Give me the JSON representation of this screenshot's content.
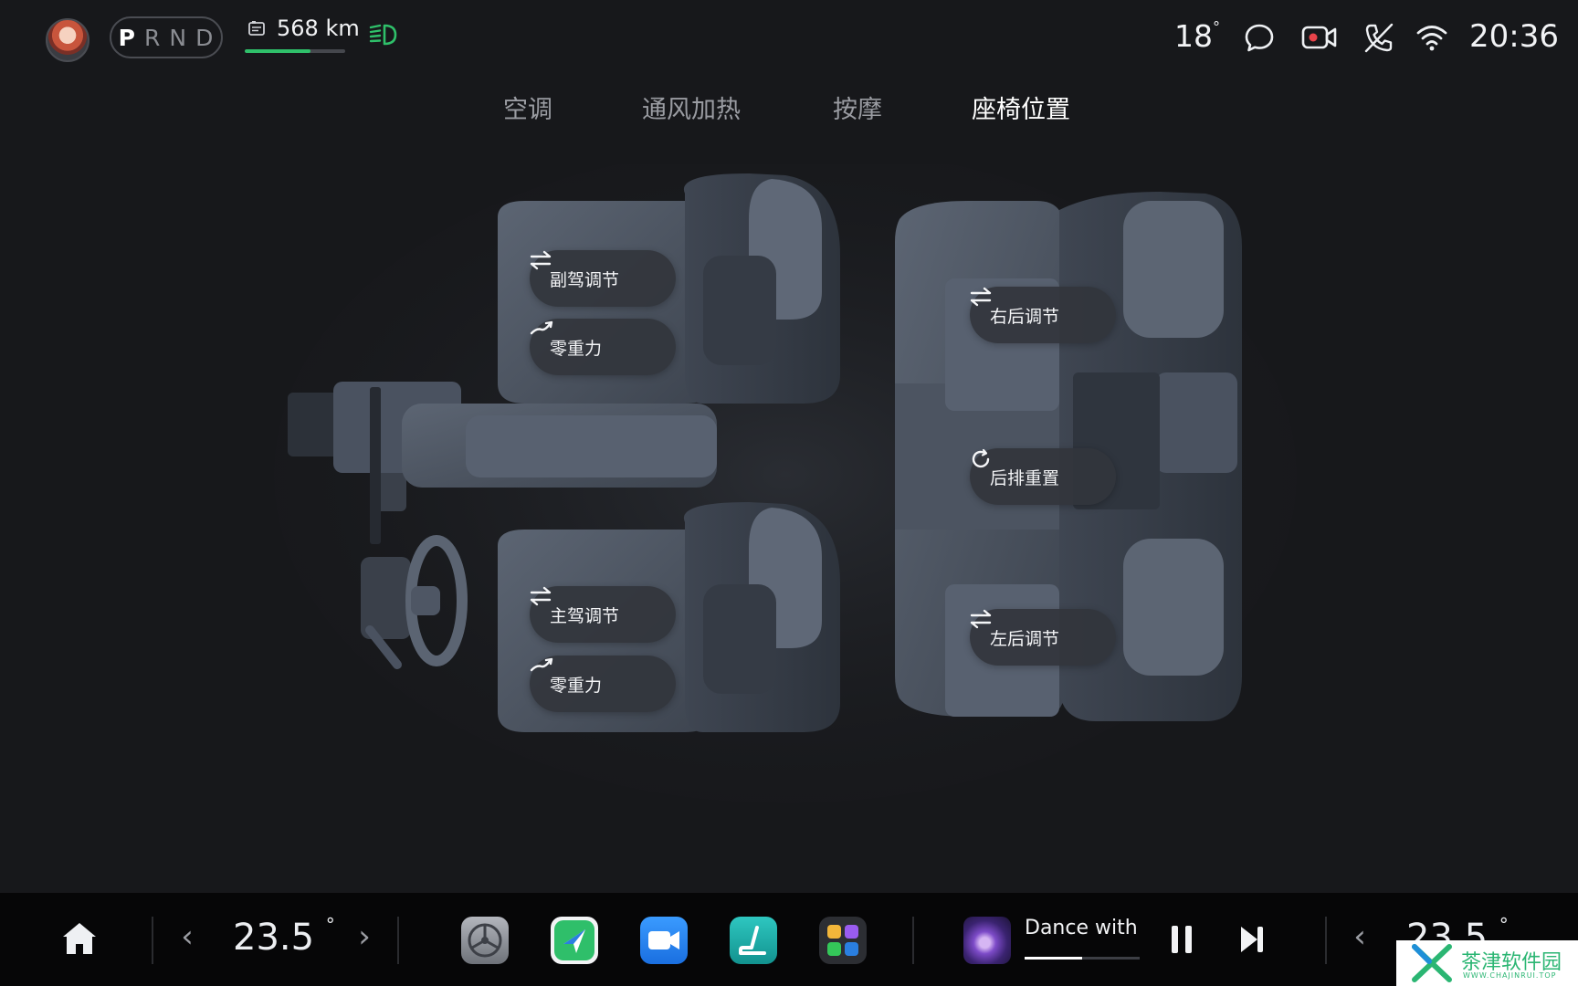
{
  "status_bar": {
    "gears": [
      "P",
      "R",
      "N",
      "D"
    ],
    "active_gear": "P",
    "range": "568 km",
    "range_level_percent": 65,
    "outside_temp": "18",
    "outside_temp_unit": "°",
    "time": "20:36",
    "icons": [
      "avatar",
      "battery-icon",
      "headlight-icon",
      "message-icon",
      "video-camera-icon",
      "phone-icon",
      "wifi-icon"
    ],
    "colors": {
      "accent_green": "#2fc06a",
      "camera_red": "#e8434a"
    }
  },
  "tabs": [
    {
      "label": "空调",
      "active": false
    },
    {
      "label": "通风加热",
      "active": false
    },
    {
      "label": "按摩",
      "active": false
    },
    {
      "label": "座椅位置",
      "active": true
    }
  ],
  "seat_controls": {
    "passenger_adjust": "副驾调节",
    "passenger_zero_gravity": "零重力",
    "driver_adjust": "主驾调节",
    "driver_zero_gravity": "零重力",
    "rear_right_adjust": "右后调节",
    "rear_reset": "后排重置",
    "rear_left_adjust": "左后调节"
  },
  "dock": {
    "left_temp": "23.5",
    "right_temp": "23.5",
    "temp_unit": "°",
    "apps": [
      "settings-app-icon",
      "navigation-app-icon",
      "video-call-app-icon",
      "seat-app-icon",
      "apps-folder-icon"
    ],
    "song_title": "Dance with",
    "song_progress_percent": 50
  },
  "watermark": {
    "text": "茶津软件园",
    "sub": "WWW.CHAJINRUI.TOP"
  }
}
